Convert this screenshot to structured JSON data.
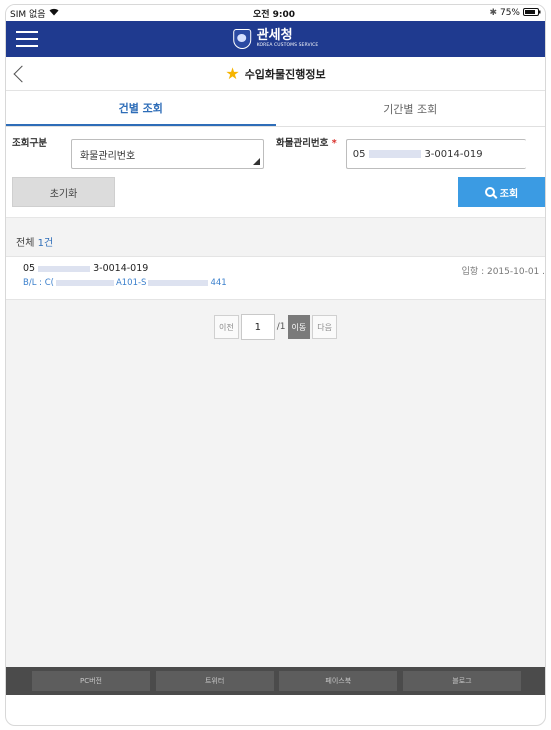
{
  "status": {
    "carrier": "SIM 없음",
    "time": "오전 9:00",
    "battery": "75%"
  },
  "brand": {
    "title": "관세청",
    "subtitle": "KOREA CUSTOMS SERVICE"
  },
  "page": {
    "title": "수입화물진행정보"
  },
  "tabs": [
    {
      "label": "건별 조회",
      "active": true
    },
    {
      "label": "기간별 조회",
      "active": false
    }
  ],
  "form": {
    "type_label": "조회구분",
    "type_value": "화물관리번호",
    "cargo_label": "화물관리번호",
    "required_mark": "*",
    "cargo_prefix": "05",
    "cargo_suffix": "3-0014-019",
    "reset_label": "초기화",
    "search_label": "조회"
  },
  "results": {
    "total_prefix": "전체 ",
    "total_count": "1건",
    "items": [
      {
        "no_prefix": "05",
        "no_suffix": "3-0014-019",
        "bl_prefix": "B/L : C(",
        "bl_mid": "A101-S",
        "bl_suffix": "441",
        "date": "입항 : 2015-10-01 ."
      }
    ]
  },
  "pager": {
    "prev": "이전",
    "page": "1",
    "of": "/1",
    "go": "이동",
    "next": "다음"
  },
  "footer": [
    "PC버전",
    "트위터",
    "페이스북",
    "블로그"
  ]
}
